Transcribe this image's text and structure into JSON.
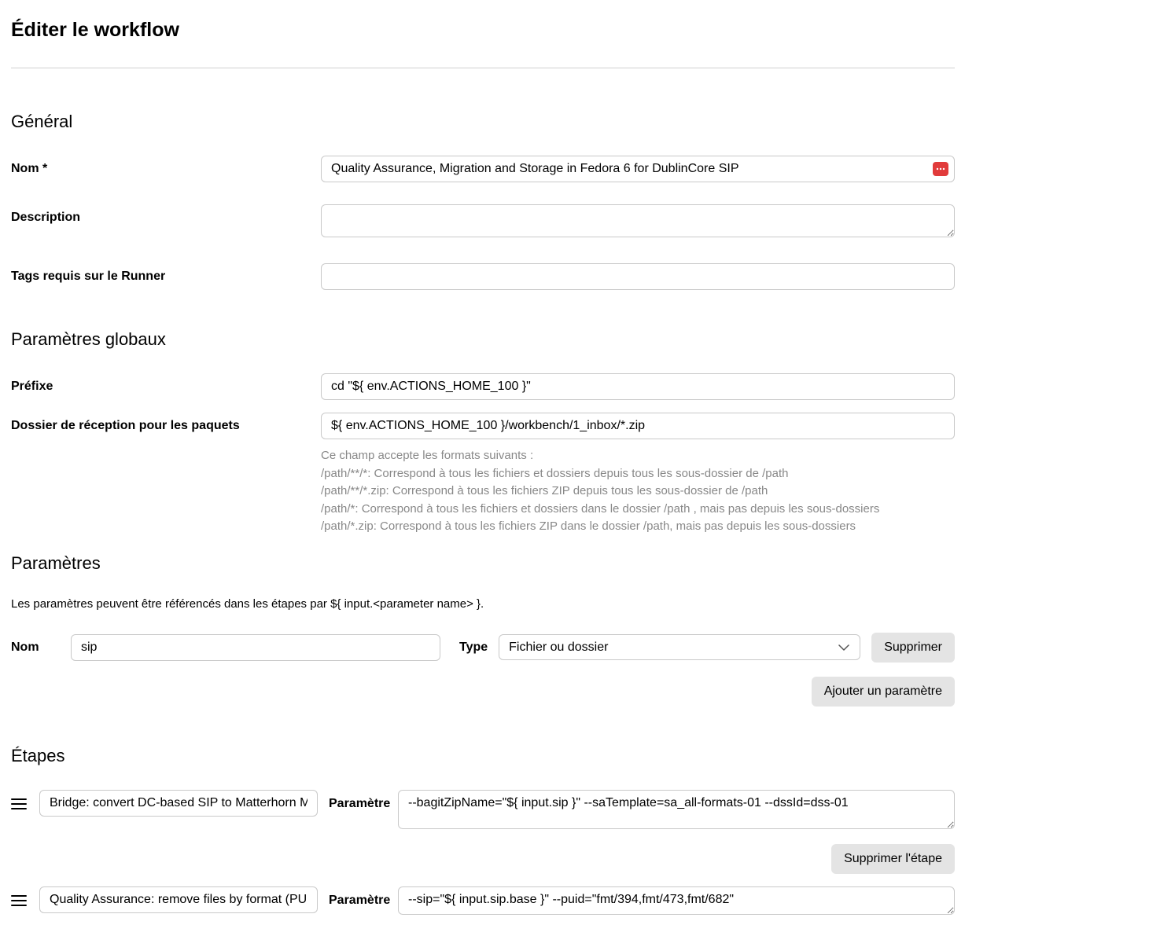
{
  "page": {
    "title": "Éditer le workflow"
  },
  "general": {
    "heading": "Général",
    "name_label": "Nom *",
    "name_value": "Quality Assurance, Migration and Storage in Fedora 6 for DublinCore SIP",
    "description_label": "Description",
    "description_value": "",
    "tags_label": "Tags requis sur le Runner",
    "tags_value": ""
  },
  "global_params": {
    "heading": "Paramètres globaux",
    "prefix_label": "Préfixe",
    "prefix_value": "cd \"${ env.ACTIONS_HOME_100 }\"",
    "inbox_label": "Dossier de réception pour les paquets",
    "inbox_value": "${ env.ACTIONS_HOME_100 }/workbench/1_inbox/*.zip",
    "help_intro": "Ce champ accepte les formats suivants :",
    "help1": "/path/**/*: Correspond à tous les fichiers et dossiers depuis tous les sous-dossier de /path",
    "help2": "/path/**/*.zip: Correspond à tous les fichiers ZIP depuis tous les sous-dossier de /path",
    "help3": "/path/*: Correspond à tous les fichiers et dossiers dans le dossier /path , mais pas depuis les sous-dossiers",
    "help4": "/path/*.zip: Correspond à tous les fichiers ZIP dans le dossier /path, mais pas depuis les sous-dossiers"
  },
  "params": {
    "heading": "Paramètres",
    "note": "Les paramètres peuvent être référencés dans les étapes par ${ input.<parameter name> }.",
    "name_label": "Nom",
    "type_label": "Type",
    "delete_label": "Supprimer",
    "add_label": "Ajouter un paramètre",
    "row": {
      "name": "sip",
      "type": "Fichier ou dossier"
    }
  },
  "steps": {
    "heading": "Étapes",
    "param_label": "Paramètre",
    "delete_step_label": "Supprimer l'étape",
    "items": [
      {
        "name": "Bridge: convert DC-based SIP to Matterhorn METS",
        "param": "--bagitZipName=\"${ input.sip }\" --saTemplate=sa_all-formats-01 --dssId=dss-01"
      },
      {
        "name": "Quality Assurance: remove files by format (PUID or MIME",
        "param": "--sip=\"${ input.sip.base }\" --puid=\"fmt/394,fmt/473,fmt/682\""
      }
    ]
  }
}
